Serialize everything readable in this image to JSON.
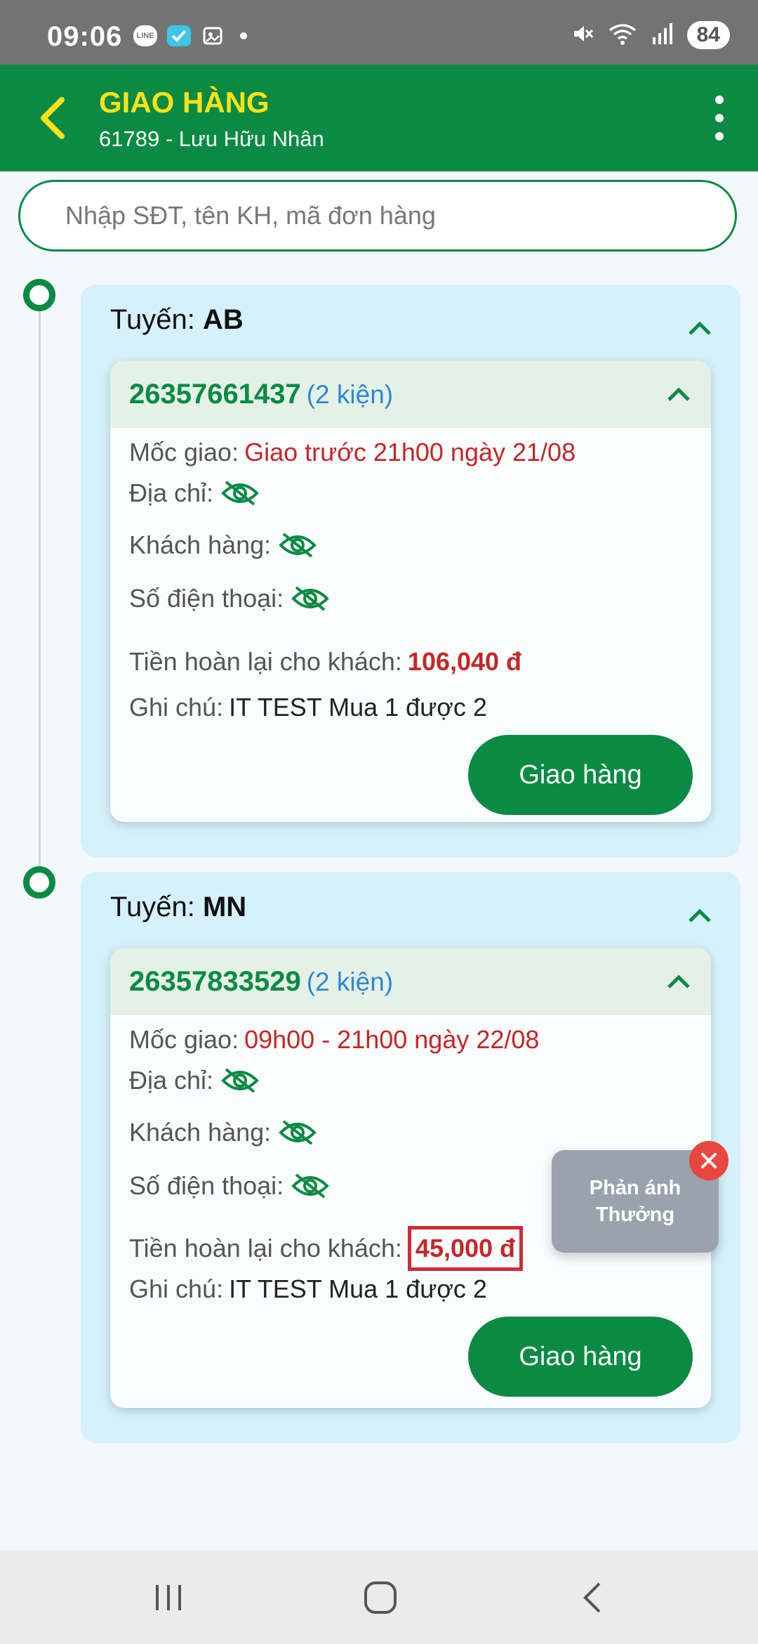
{
  "status_bar": {
    "time": "09:06",
    "battery": "84",
    "left_icons": [
      "line-icon",
      "check-app-icon",
      "screenshot-icon",
      "dot-icon"
    ],
    "right_icons": [
      "mute-icon",
      "wifi-icon",
      "signal-icon"
    ]
  },
  "header": {
    "title": "GIAO HÀNG",
    "subtitle": "61789 - Lưu Hữu Nhân"
  },
  "search": {
    "placeholder": "Nhập SĐT, tên KH, mã đơn hàng"
  },
  "labels": {
    "route_prefix": "Tuyến:",
    "milestone": "Mốc giao:",
    "address": "Địa chỉ:",
    "customer": "Khách hàng:",
    "phone": "Số điện thoại:",
    "refund": "Tiền hoàn lại cho khách:",
    "note": "Ghi chú:",
    "deliver_button": "Giao hàng"
  },
  "routes": [
    {
      "name": "AB",
      "order": {
        "id": "26357661437",
        "packages": "(2 kiện)",
        "milestone": "Giao trước 21h00 ngày 21/08",
        "refund": "106,040 đ",
        "note": "IT TEST Mua 1 được 2"
      }
    },
    {
      "name": "MN",
      "order": {
        "id": "26357833529",
        "packages": "(2 kiện)",
        "milestone": "09h00 - 21h00 ngày 22/08",
        "refund": "45,000 đ",
        "note": "IT TEST Mua 1 được 2"
      }
    }
  ],
  "feedback": {
    "line1": "Phản ánh",
    "line2": "Thưởng"
  },
  "colors": {
    "primary": "#0a8a43",
    "title_yellow": "#ffe11a",
    "route_bg": "#d5f1fb",
    "danger": "#c42727",
    "link_blue": "#2f86d6"
  }
}
